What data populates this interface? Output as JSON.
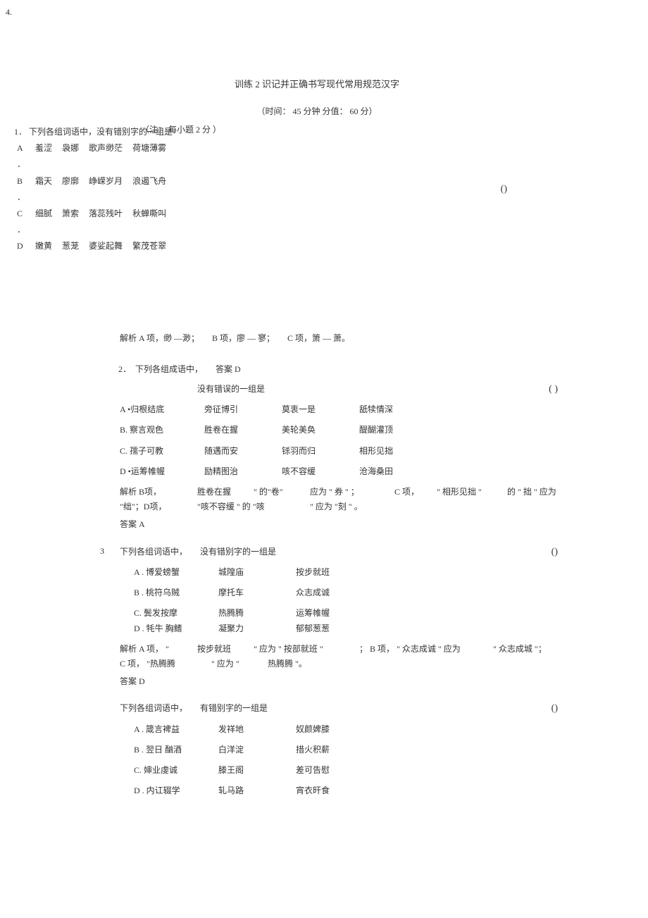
{
  "topLeftNum": "4.",
  "title": "训练 2 识记并正确书写现代常用规范汉字",
  "subtitle": "（时间： 45 分钟  分值： 60 分）",
  "noteOverlap": "（注： 每小题 2 分 ）",
  "q1": {
    "num": "1．",
    "stem": "下列各组词语中，没有错别字的一组是",
    "paren": "()",
    "rows": [
      {
        "label": "A",
        "dot": "．",
        "c1": "羞涩",
        "c2": "袅娜",
        "c3": "歌声缈茫",
        "c4": "荷塘薄雾"
      },
      {
        "label": "B",
        "dot": "．",
        "c1": "霜天",
        "c2": "廖廓",
        "c3": "峥嵘岁月",
        "c4": "浪遏飞舟"
      },
      {
        "label": "C",
        "dot": "．",
        "c1": "细腻",
        "c2": "箫索",
        "c3": "落蕊残叶",
        "c4": "秋蝉嘶叫"
      },
      {
        "label": "D",
        "dot": "．",
        "c1": "嫩黄",
        "c2": "葱茏",
        "c3": "婆娑起舞",
        "c4": "繁茂苍翠"
      }
    ]
  },
  "q1_ana": {
    "prefix": "解析 A 项，缈 —渺；",
    "p2": "B 项，廖 — 寥；",
    "p3": "C 项，箫 — 萧。"
  },
  "q2": {
    "num": "2．",
    "stem1": "下列各组成语中，",
    "ans": "答案  D",
    "stem2": "没有错误的一组是",
    "paren": "(         )",
    "opts": [
      {
        "label": "A •归根结底",
        "c1": "旁征博引",
        "c2": "莫衷一是",
        "c3": "舐犊情深"
      },
      {
        "label": "B. 察言观色",
        "c1": "胜卷在握",
        "c2": "美轮美奂",
        "c3": "醍醐灌顶"
      },
      {
        "label": "C. 孺子可教",
        "c1": "随遇而安",
        "c2": "铩羽而归",
        "c3": "相形见拙"
      },
      {
        "label": "D •运筹帷幄",
        "c1": "励精图治",
        "c2": "咳不容缓",
        "c3": "沧海桑田"
      }
    ],
    "ana": {
      "l1a": "解析  B项，",
      "l1b": "胜卷在握",
      "l1c": "\" 的\"卷\"",
      "l1d": "应为 \" 券 \" ；",
      "l1e": "C 项，",
      "l1f": "\" 相形见拙 \"",
      "l1g": "的 \" 拙 \" 应为",
      "l2a": "\"绌\"；D项，",
      "l2b": "\"咳不容缓 \"  的 \"咳",
      "l2c": "\"  应为 \"刻 \" 。"
    },
    "ans2": "答案  A"
  },
  "q3": {
    "num": "3",
    "stem": "下列各组词语中，",
    "stem2": "没有错别字的一组是",
    "paren": "()",
    "opts": [
      {
        "label": "A . 博爱螃蟹",
        "c1": "城隍庙",
        "c2": "按步就班"
      },
      {
        "label": "B . 桃符乌贼",
        "c1": "摩托车",
        "c2": "众志成诚"
      },
      {
        "label": "C. 鬓发按摩",
        "c1": "热腾腾",
        "c2": "运筹帷幄"
      },
      {
        "label": "D . 牦牛  胸鳍",
        "c1": "凝聚力",
        "c2": "郁郁葱葱"
      }
    ],
    "ana": {
      "l1a": "解析 A 项， \"",
      "l1b": "按步就班",
      "l1c": "\" 应为 \" 按部就班 \"",
      "l1d": "； B 项， \" 众志成诚 \" 应为",
      "l1e": "\" 众志成城 \"；",
      "l2a": "C 项，   \"热腾腾",
      "l2b": "\" 应为 \"",
      "l2c": "热腾腾 \"。"
    },
    "ans": "答案  D"
  },
  "q4": {
    "stem": "下列各组词语中，",
    "stem2": "有错别字的一组是",
    "paren": "()",
    "opts": [
      {
        "label": "A . 箴言裨益",
        "c1": "发祥地",
        "c2": "奴颜婢膝"
      },
      {
        "label": "B . 翌日 酗酒",
        "c1": "白洋淀",
        "c2": "措火积薪"
      },
      {
        "label": "C. 婶业虔诚",
        "c1": "滕王阁",
        "c2": "差可告慰"
      },
      {
        "label": "D . 内讧辍学",
        "c1": "轧马路",
        "c2": "宵衣旰食"
      }
    ]
  }
}
